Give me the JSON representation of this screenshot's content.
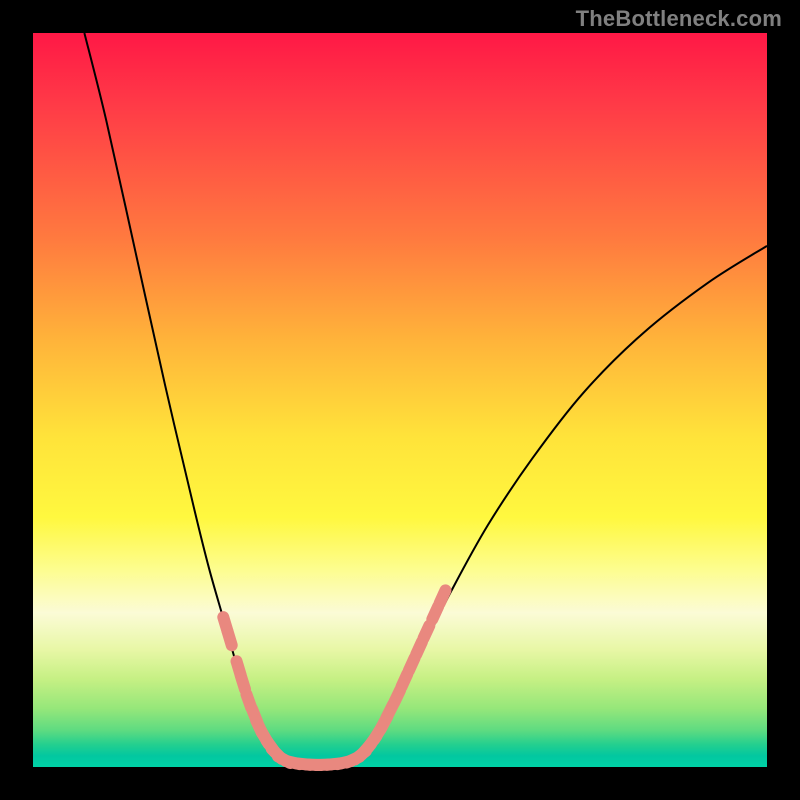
{
  "watermark": {
    "text": "TheBottleneck.com"
  },
  "colors": {
    "curve_stroke": "#000000",
    "marker_fill": "#e9887f",
    "marker_stroke": "#e9887f",
    "gradient_top": "#ff1846",
    "gradient_bottom": "#00d2a6"
  },
  "chart_data": {
    "type": "line",
    "title": "",
    "xlabel": "",
    "ylabel": "",
    "xlim": [
      0,
      100
    ],
    "ylim": [
      0,
      100
    ],
    "grid": false,
    "legend": false,
    "annotations": [],
    "series": [
      {
        "name": "left-curve",
        "x": [
          7,
          10,
          14,
          18,
          22,
          24,
          26,
          28,
          29,
          30,
          31,
          32,
          33,
          34
        ],
        "y": [
          100,
          88,
          70,
          52,
          35,
          27,
          20,
          13,
          10,
          7,
          5,
          3,
          2,
          1
        ]
      },
      {
        "name": "valley-floor",
        "x": [
          34,
          36,
          38,
          40,
          42,
          44
        ],
        "y": [
          1,
          0.5,
          0.3,
          0.3,
          0.5,
          1
        ]
      },
      {
        "name": "right-curve",
        "x": [
          44,
          46,
          48,
          50,
          53,
          57,
          62,
          68,
          75,
          83,
          92,
          100
        ],
        "y": [
          1,
          3,
          6,
          10,
          16,
          24,
          33,
          42,
          51,
          59,
          66,
          71
        ]
      }
    ],
    "markers": {
      "name": "highlighted-segment",
      "shape": "rounded-dash",
      "color": "#e9887f",
      "points": [
        {
          "x": 26.2,
          "y": 19.5
        },
        {
          "x": 26.8,
          "y": 17.5
        },
        {
          "x": 28.0,
          "y": 13.5
        },
        {
          "x": 28.6,
          "y": 11.5
        },
        {
          "x": 29.4,
          "y": 9.0
        },
        {
          "x": 30.2,
          "y": 7.0
        },
        {
          "x": 30.8,
          "y": 5.5
        },
        {
          "x": 31.6,
          "y": 4.0
        },
        {
          "x": 32.4,
          "y": 2.8
        },
        {
          "x": 33.2,
          "y": 1.8
        },
        {
          "x": 34.2,
          "y": 1.0
        },
        {
          "x": 35.4,
          "y": 0.6
        },
        {
          "x": 36.8,
          "y": 0.4
        },
        {
          "x": 38.2,
          "y": 0.3
        },
        {
          "x": 39.6,
          "y": 0.3
        },
        {
          "x": 41.0,
          "y": 0.4
        },
        {
          "x": 42.4,
          "y": 0.6
        },
        {
          "x": 43.6,
          "y": 1.0
        },
        {
          "x": 44.6,
          "y": 1.6
        },
        {
          "x": 45.4,
          "y": 2.4
        },
        {
          "x": 46.2,
          "y": 3.4
        },
        {
          "x": 47.0,
          "y": 4.6
        },
        {
          "x": 47.8,
          "y": 6.0
        },
        {
          "x": 48.6,
          "y": 7.6
        },
        {
          "x": 49.6,
          "y": 9.6
        },
        {
          "x": 50.6,
          "y": 11.8
        },
        {
          "x": 51.6,
          "y": 14.0
        },
        {
          "x": 52.6,
          "y": 16.2
        },
        {
          "x": 53.6,
          "y": 18.4
        },
        {
          "x": 54.8,
          "y": 21.0
        },
        {
          "x": 55.8,
          "y": 23.2
        }
      ]
    }
  }
}
